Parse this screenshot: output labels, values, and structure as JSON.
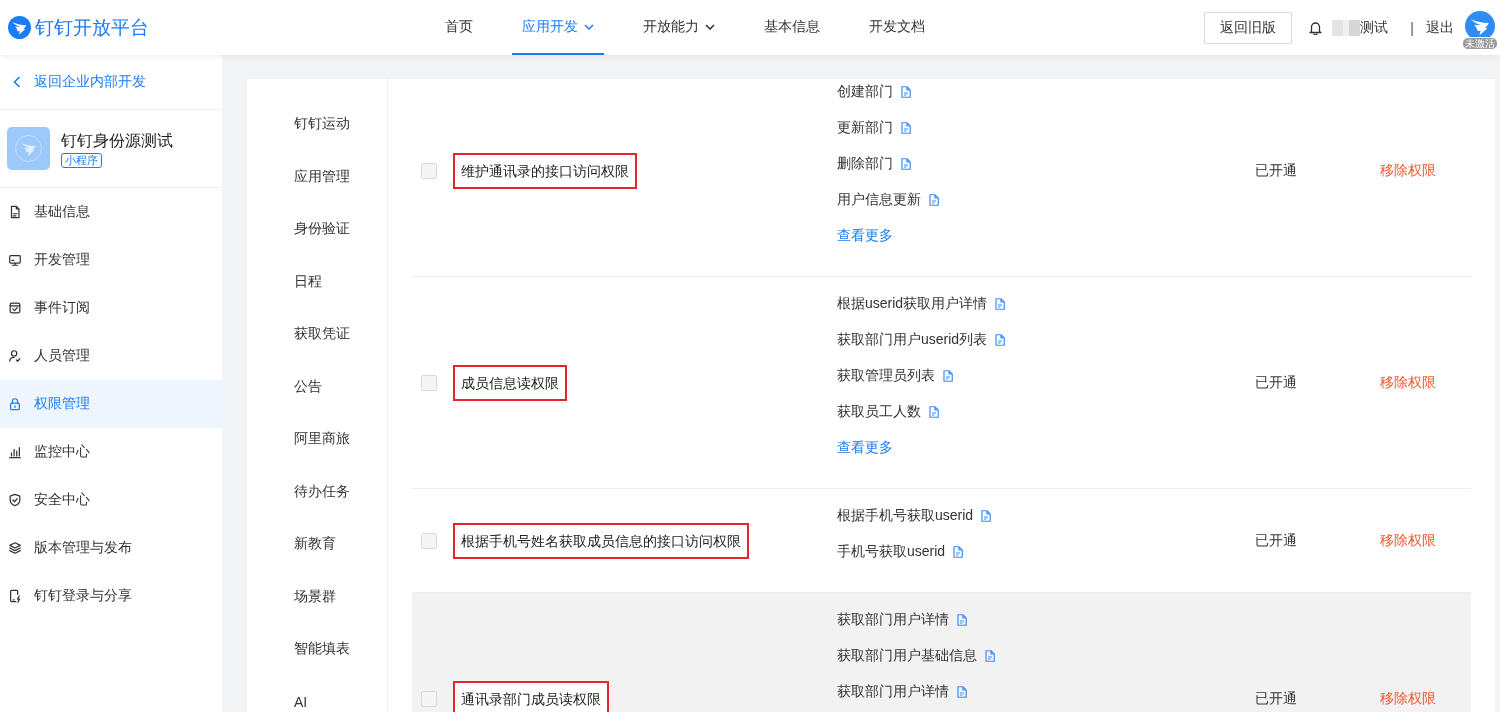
{
  "header": {
    "logo_text": "钉钉开放平台",
    "nav": [
      {
        "label": "首页",
        "selected": false,
        "dropdown": false
      },
      {
        "label": "应用开发",
        "selected": true,
        "dropdown": true
      },
      {
        "label": "开放能力",
        "selected": false,
        "dropdown": true
      },
      {
        "label": "基本信息",
        "selected": false,
        "dropdown": false
      },
      {
        "label": "开发文档",
        "selected": false,
        "dropdown": false
      }
    ],
    "old_version_button": "返回旧版",
    "user_name": "测试",
    "separator": "|",
    "logout": "退出",
    "avatar_badge": "未激活"
  },
  "sidebar": {
    "back_link": "返回企业内部开发",
    "app": {
      "name": "钉钉身份源测试",
      "tag": "小程序"
    },
    "items": [
      {
        "label": "基础信息",
        "selected": false
      },
      {
        "label": "开发管理",
        "selected": false
      },
      {
        "label": "事件订阅",
        "selected": false
      },
      {
        "label": "人员管理",
        "selected": false
      },
      {
        "label": "权限管理",
        "selected": true
      },
      {
        "label": "监控中心",
        "selected": false
      },
      {
        "label": "安全中心",
        "selected": false
      },
      {
        "label": "版本管理与发布",
        "selected": false
      },
      {
        "label": "钉钉登录与分享",
        "selected": false
      }
    ]
  },
  "categories": [
    "钉钉运动",
    "应用管理",
    "身份验证",
    "日程",
    "获取凭证",
    "公告",
    "阿里商旅",
    "待办任务",
    "新教育",
    "场景群",
    "智能填表",
    "AI"
  ],
  "permissions": [
    {
      "name": "维护通讯录的接口访问权限",
      "highlighted": true,
      "checked": false,
      "hovered": false,
      "apis": [
        "创建部门",
        "更新部门",
        "删除部门",
        "用户信息更新"
      ],
      "more_link": "查看更多",
      "status": "已开通",
      "action": "移除权限"
    },
    {
      "name": "成员信息读权限",
      "highlighted": true,
      "checked": false,
      "hovered": false,
      "apis": [
        "根据userid获取用户详情",
        "获取部门用户userid列表",
        "获取管理员列表",
        "获取员工人数"
      ],
      "more_link": "查看更多",
      "status": "已开通",
      "action": "移除权限"
    },
    {
      "name": "根据手机号姓名获取成员信息的接口访问权限",
      "highlighted": true,
      "checked": false,
      "hovered": false,
      "apis": [
        "根据手机号获取userid",
        "手机号获取userid"
      ],
      "status": "已开通",
      "action": "移除权限"
    },
    {
      "name": "通讯录部门成员读权限",
      "highlighted": true,
      "checked": false,
      "hovered": true,
      "apis": [
        "获取部门用户详情",
        "获取部门用户基础信息",
        "获取部门用户详情"
      ],
      "status": "已开通",
      "action": "移除权限"
    }
  ]
}
